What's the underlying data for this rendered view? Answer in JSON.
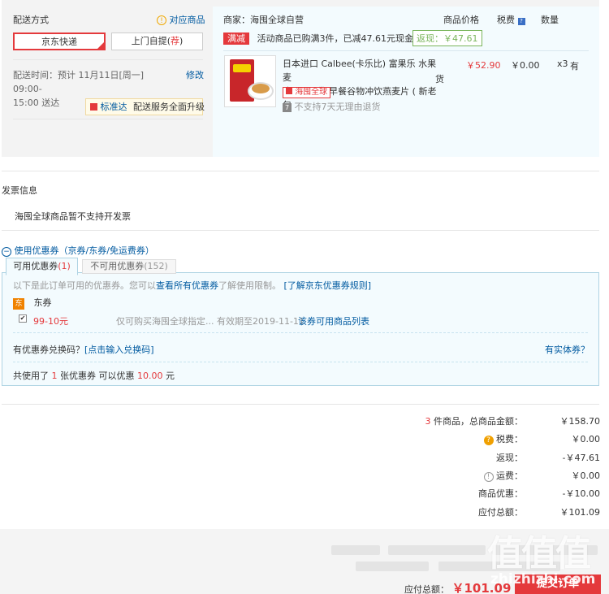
{
  "delivery": {
    "heading": "配送方式",
    "match_link": "对应商品",
    "option_express": "京东快递",
    "option_pickup_prefix": "上门自提(",
    "option_pickup_suffix": "荐",
    "option_pickup_close": ")",
    "time_text_line1": "配送时间：预计 11月11日[周一] 09:00-",
    "time_text_line2": "15:00 送达",
    "modify_link": "修改",
    "std_badge": "标准达",
    "std_text": "配送服务全面升级"
  },
  "shop": {
    "seller": "商家：海囤全球自营",
    "col_price": "商品价格",
    "col_tax": "税费",
    "col_qty": "数量",
    "promo_tag": "满减",
    "promo_text": "活动商品已购满3件，已减47.61元现金",
    "rebate_tag": "返现：￥47.61",
    "item": {
      "title_line1": "日本进口 Calbee(卡乐比) 富果乐 水果麦",
      "title_line2": "片700g/袋 早餐谷物冲饮燕麦片 ( 新老包",
      "price": "￥52.90",
      "tax": "￥0.00",
      "qty": "x3",
      "stock_line1": "有",
      "stock_line2": "货",
      "global_badge": "海囤全球",
      "no_return": "不支持7天无理由退货"
    }
  },
  "invoice": {
    "heading": "发票信息",
    "text": "海囤全球商品暂不支持开发票"
  },
  "coupon": {
    "toggle_label": "使用优惠券（京券/东券/免运费券）",
    "tab_available_label": "可用优惠券",
    "tab_available_count": "(1)",
    "tab_unavailable_label": "不可用优惠券",
    "tab_unavailable_count": "(152)",
    "desc_prefix": "以下是此订单可用的优惠券。您可以",
    "desc_link1": "查看所有优惠券",
    "desc_mid": "了解使用限制。",
    "desc_link2": "[了解京东优惠券规则]",
    "type_badge": "东",
    "type_label": "东券",
    "coupon_name": "99-10元",
    "coupon_desc": "仅可购买海囤全球指定...  有效期至2019-11-11",
    "coupon_link": "该券可用商品列表",
    "redeem_prefix": "有优惠券兑换码？",
    "redeem_link": "[点击输入兑换码]",
    "physical_link": "有实体券？",
    "used_prefix": "共使用了",
    "used_count": "1",
    "used_mid": "张优惠券  可以优惠",
    "used_amount": "10.00",
    "used_suffix": "元"
  },
  "summary": {
    "items_count": "3",
    "items_label": "件商品，总商品金额：",
    "items_total": "￥158.70",
    "tax_label": "税费：",
    "tax_value": "￥0.00",
    "rebate_label": "返现：",
    "rebate_value": "-￥47.61",
    "shipping_label": "运费：",
    "shipping_value": "￥0.00",
    "discount_label": "商品优惠：",
    "discount_value": "-￥10.00",
    "total_label": "应付总额：",
    "total_value": "￥101.09"
  },
  "footer": {
    "payable_label": "应付总额：",
    "payable_value": "￥101.09",
    "submit_label": "提交订单",
    "watermark_main": "值值值",
    "watermark_site": "zhizhizhi.com"
  },
  "colors": {
    "accent_red": "#e4393c",
    "link_blue": "#005aa0",
    "panel_blue": "#f3fbfe"
  }
}
